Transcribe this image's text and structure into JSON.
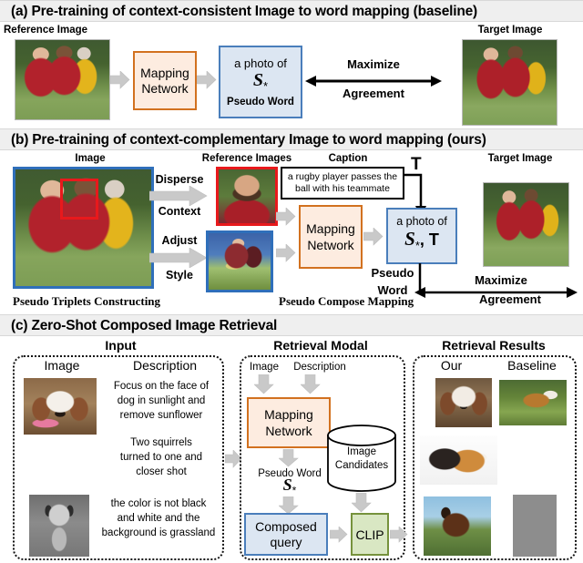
{
  "panels": {
    "a": {
      "header": "(a) Pre-training of context-consistent Image to word mapping (baseline)",
      "reference_label": "Reference Image",
      "target_label": "Target Image",
      "mapping_line1": "Mapping",
      "mapping_line2": "Network",
      "prompt_line1": "a photo of",
      "prompt_token": "S",
      "prompt_token_sub": "*",
      "prompt_caption": "Pseudo Word",
      "objective_line1": "Maximize",
      "objective_line2": "Agreement"
    },
    "b": {
      "header": "(b) Pre-training of context-complementary Image to word mapping (ours)",
      "image_label": "Image",
      "reference_images_label": "Reference Images",
      "caption_label": "Caption",
      "caption_text_line1": "a rugby player passes the",
      "caption_text_line2": "ball with his teammate",
      "caption_symbol": "T",
      "target_label": "Target Image",
      "op1_line1": "Disperse",
      "op1_line2": "Context",
      "op2_line1": "Adjust",
      "op2_line2": "Style",
      "mapping_line1": "Mapping",
      "mapping_line2": "Network",
      "prompt_line1": "a photo of",
      "prompt_token": "S",
      "prompt_token_sub": "*",
      "prompt_token_suffix": ", T",
      "pseudo_word_line1": "Pseudo",
      "pseudo_word_line2": "Word",
      "stage1_caption": "Pseudo Triplets Constructing",
      "stage2_caption": "Pseudo Compose Mapping",
      "objective_line1": "Maximize",
      "objective_line2": "Agreement"
    },
    "c": {
      "header": "(c) Zero-Shot Composed Image Retrieval",
      "groups": {
        "input_title": "Input",
        "retrieval_modal_title": "Retrieval Modal",
        "retrieval_results_title": "Retrieval Results"
      },
      "input": {
        "col_image": "Image",
        "col_description": "Description",
        "rows": [
          {
            "description_lines": [
              "Focus on the face of",
              "dog in sunlight and",
              "remove sunflower"
            ]
          },
          {
            "description_lines": [
              "Two squirrels",
              "turned to one and",
              "closer shot"
            ]
          },
          {
            "description_lines": [
              "the color is not black",
              "and white and the",
              "background is grassland"
            ]
          }
        ]
      },
      "modal": {
        "in_image": "Image",
        "in_description": "Description",
        "mapping_line1": "Mapping",
        "mapping_line2": "Network",
        "pseudo_word_label": "Pseudo Word",
        "pseudo_word_token": "S",
        "pseudo_word_sub": "*",
        "candidates_line1": "Image",
        "candidates_line2": "Candidates",
        "composed_line1": "Composed",
        "composed_line2": "query",
        "clip_label": "CLIP"
      },
      "results": {
        "col_our": "Our",
        "col_baseline": "Baseline"
      }
    }
  },
  "colors": {
    "header_bg": "#efefef",
    "mapping_fill": "#fdece0",
    "mapping_border": "#d2711f",
    "prompt_fill": "#dce6f2",
    "prompt_border": "#4a7ebb",
    "clip_fill": "#d9e7c3",
    "clip_border": "#76923c",
    "frame_blue": "#2f6fba",
    "frame_red": "#e8191c",
    "arrow_gray": "#c9c9c9"
  }
}
